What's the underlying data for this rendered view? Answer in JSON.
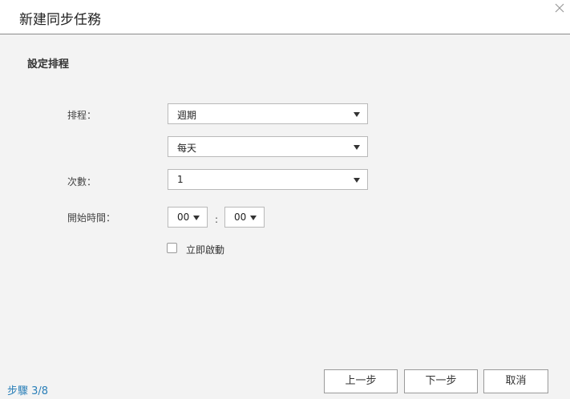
{
  "dialog": {
    "title": "新建同步任務",
    "section_title": "設定排程"
  },
  "form": {
    "schedule_label": "排程：",
    "schedule_value": "週期",
    "frequency_value": "每天",
    "count_label": "次數：",
    "count_value": "1",
    "start_time_label": "開始時間：",
    "hour_value": "00",
    "minute_value": "00",
    "time_separator": ":",
    "start_now_label": "立即啟動"
  },
  "footer": {
    "step": "步驟 3/8",
    "prev_label": "上一步",
    "next_label": "下一步",
    "cancel_label": "取消"
  }
}
